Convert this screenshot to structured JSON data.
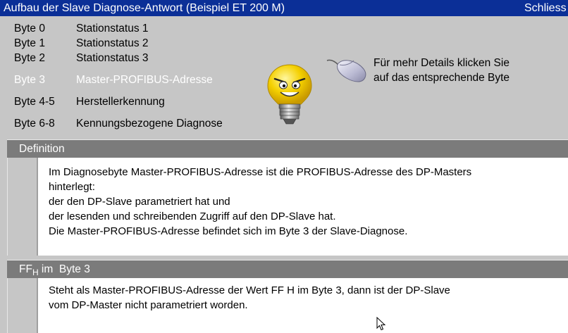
{
  "window": {
    "title": "Aufbau der Slave Diagnose-Antwort (Beispiel ET 200 M)",
    "close_label": "Schliess"
  },
  "bytes": [
    {
      "label": "Byte 0",
      "desc": "Stationstatus 1",
      "active": false
    },
    {
      "label": "Byte 1",
      "desc": "Stationstatus 2",
      "active": false
    },
    {
      "label": "Byte 2",
      "desc": "Stationstatus 3",
      "active": false
    },
    {
      "label": "Byte 3",
      "desc": "Master-PROFIBUS-Adresse",
      "active": true
    },
    {
      "label": "Byte 4-5",
      "desc": "Herstellerkennung",
      "active": false
    },
    {
      "label": "Byte 6-8",
      "desc": "Kennungsbezogene Diagnose",
      "active": false
    }
  ],
  "hint": {
    "line1": "Für mehr Details klicken Sie",
    "line2": "auf das entsprechende Byte"
  },
  "definition": {
    "heading": "Definition",
    "lines": [
      "Im Diagnosebyte Master-PROFIBUS-Adresse ist die PROFIBUS-Adresse des DP-Masters",
      "hinterlegt:",
      " der den DP-Slave parametriert hat und",
      " der lesenden und schreibenden Zugriff auf den DP-Slave hat.",
      "Die Master-PROFIBUS-Adresse befindet sich im Byte 3 der Slave-Diagnose."
    ]
  },
  "ffh": {
    "heading_main": "FF",
    "heading_sub": "H",
    "heading_rest": " im  Byte 3",
    "lines": [
      "Steht als Master-PROFIBUS-Adresse der Wert FF H im Byte 3, dann ist der DP-Slave",
      "vom DP-Master nicht parametriert worden."
    ]
  },
  "colors": {
    "titlebar": "#0b2f97",
    "background": "#c6c6c6",
    "panel_header": "#7b7b7b",
    "active_text": "#ffffff"
  },
  "icons": {
    "bulb": "lightbulb-face-icon",
    "mouse": "mouse-icon",
    "cursor": "mouse-pointer-icon"
  }
}
